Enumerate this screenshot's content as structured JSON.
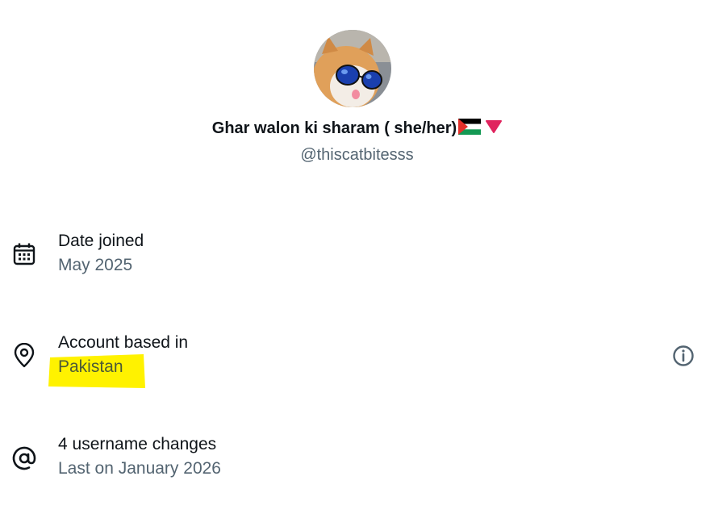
{
  "profile": {
    "display_name": "Ghar walon ki sharam ( she/her)",
    "display_name_icons": [
      "palestine-flag-icon",
      "red-heart-icon"
    ],
    "username": "@thiscatbitesss",
    "avatar": "cat-with-sunglasses"
  },
  "rows": [
    {
      "icon": "calendar-icon",
      "title": "Date joined",
      "subtitle": "May 2025"
    },
    {
      "icon": "location-pin-icon",
      "title": "Account based in",
      "subtitle": "Pakistan",
      "highlighted": true,
      "trailing_icon": "info-icon"
    },
    {
      "icon": "at-sign-icon",
      "title": "4 username changes",
      "subtitle": "Last on January 2026"
    }
  ],
  "colors": {
    "primary_text": "#0f1419",
    "secondary_text": "#536471",
    "highlight": "#fff200",
    "heart": "#e0245e"
  }
}
